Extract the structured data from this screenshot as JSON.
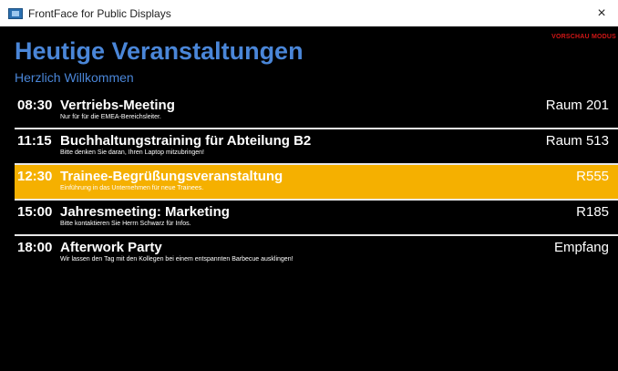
{
  "window": {
    "title": "FrontFace for Public Displays",
    "close_label": "×"
  },
  "badge": "VORSCHAU MODUS",
  "heading": "Heutige Veranstaltungen",
  "subheading": "Herzlich Willkommen",
  "events": [
    {
      "time": "08:30",
      "title": "Vertriebs-Meeting",
      "desc": "Nur für für die EMEA-Bereichsleiter.",
      "room": "Raum 201"
    },
    {
      "time": "11:15",
      "title": "Buchhaltungstraining für Abteilung B2",
      "desc": "Bitte denken Sie daran, Ihren Laptop mitzubringen!",
      "room": "Raum 513"
    },
    {
      "time": "12:30",
      "title": "Trainee-Begrüßungsveranstaltung",
      "desc": "Einführung in das Unternehmen für neue Trainees.",
      "room": "R555"
    },
    {
      "time": "15:00",
      "title": "Jahresmeeting: Marketing",
      "desc": "Bitte kontaktieren Sie Herrn Schwarz für Infos.",
      "room": "R185"
    },
    {
      "time": "18:00",
      "title": "Afterwork Party",
      "desc": "Wir lassen den Tag mit den Kollegen bei einem entspannten Barbecue ausklingen!",
      "room": "Empfang"
    }
  ],
  "colors": {
    "accent": "#4a86d8",
    "highlight": "#f5b000",
    "badge": "#d11616"
  }
}
